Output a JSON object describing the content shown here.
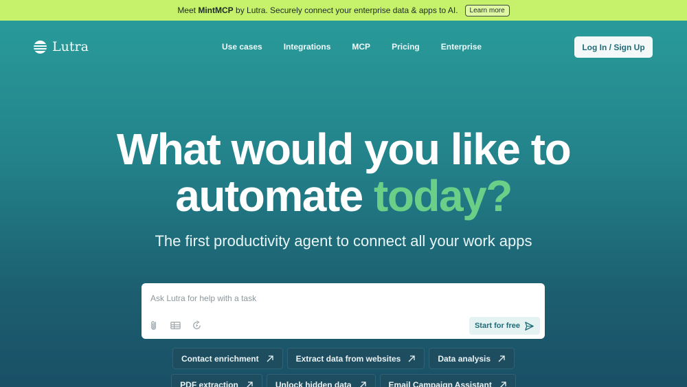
{
  "banner": {
    "prefix": "Meet",
    "product": "MintMCP",
    "text": "by Lutra. Securely connect your enterprise data & apps to AI.",
    "link_label": "Learn more"
  },
  "brand": {
    "name": "Lutra",
    "icon": "lutra-logo-icon"
  },
  "nav": {
    "items": [
      "Use cases",
      "Integrations",
      "MCP",
      "Pricing",
      "Enterprise"
    ],
    "login_label": "Log In / Sign Up"
  },
  "hero": {
    "line1": "What would you like to",
    "line2_main": "automate",
    "line2_accent": "today?",
    "subhead": "The first productivity agent to connect all your work apps"
  },
  "task": {
    "placeholder": "Ask Lutra for help with a task",
    "tools": [
      "paperclip-icon",
      "table-icon",
      "replay-icon"
    ],
    "start_label": "Start for free"
  },
  "suggestions": {
    "row1": [
      "Contact enrichment",
      "Extract data from websites",
      "Data analysis"
    ],
    "row2": [
      "PDF extraction",
      "Unlock hidden data",
      "Email Campaign Assistant"
    ]
  },
  "colors": {
    "accent": "#6ccf88",
    "banner": "#c6f16a",
    "brand_teal": "#1f6c78"
  }
}
